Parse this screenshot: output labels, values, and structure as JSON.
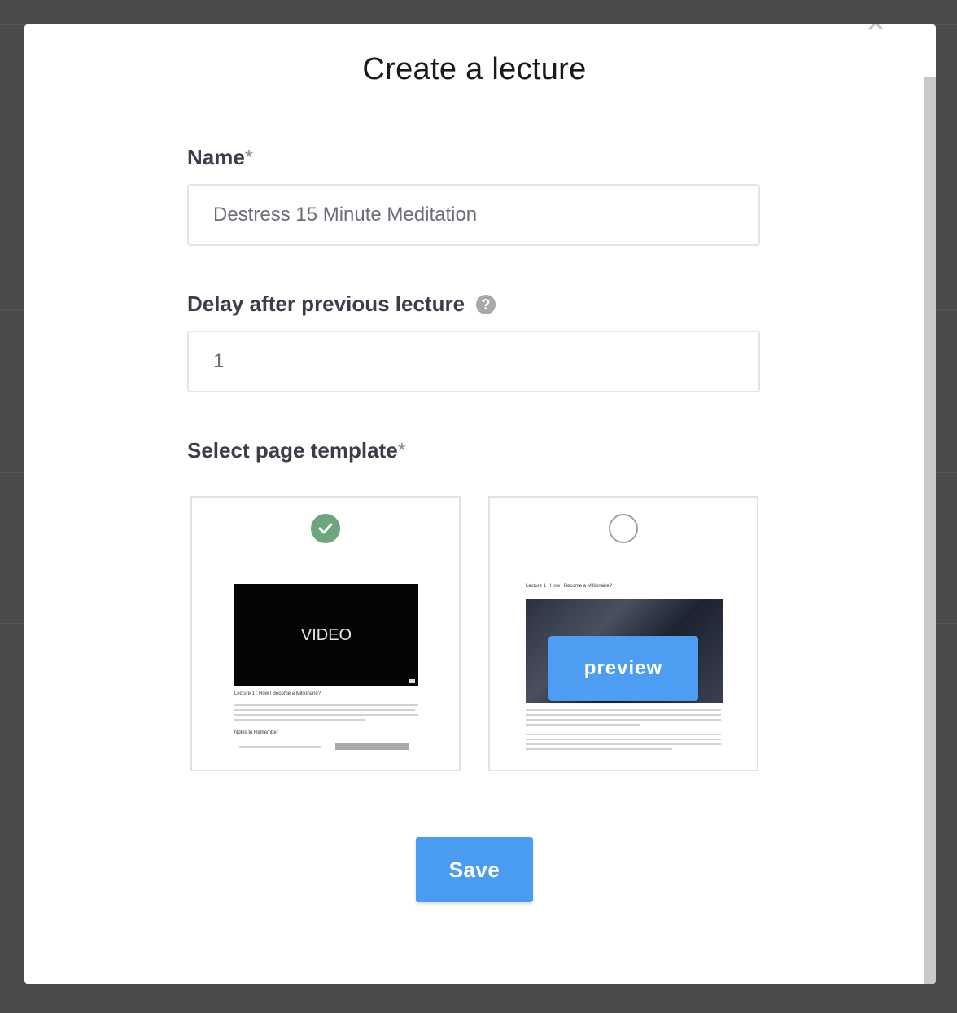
{
  "modal": {
    "title": "Create a lecture",
    "close_icon": "close-icon"
  },
  "form": {
    "name": {
      "label": "Name",
      "required_mark": "*",
      "value": "Destress 15 Minute Meditation"
    },
    "delay": {
      "label": "Delay after previous lecture",
      "help_icon": "question-circle-icon",
      "help_glyph": "?",
      "value": "1"
    },
    "template": {
      "label": "Select page template",
      "required_mark": "*",
      "options": [
        {
          "selected": true,
          "video_text": "VIDEO",
          "heading": "Lecture 1 : How I Become a Millionaire?",
          "notes_heading": "Notes to Remember"
        },
        {
          "selected": false,
          "heading": "Lecture 1 : How I Become a Millionaire?",
          "preview_label": "preview"
        }
      ]
    }
  },
  "actions": {
    "save_label": "Save"
  },
  "colors": {
    "overlay": "#4a4a4c",
    "primary_button": "#4a9bf2",
    "selected_check": "#6fa57e",
    "label_text": "#3b3e4a"
  }
}
